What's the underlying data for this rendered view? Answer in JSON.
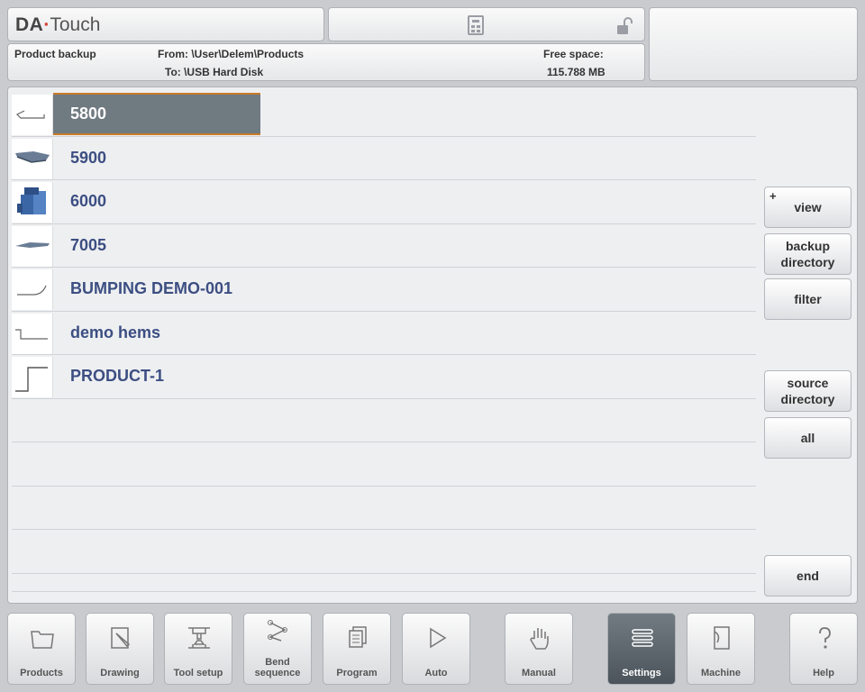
{
  "header": {
    "logo_bold": "DA",
    "logo_dot": "·",
    "logo_light": "Touch"
  },
  "status": {
    "mode": "Product backup",
    "from": "From: \\User\\Delem\\Products",
    "to": "To: \\USB Hard Disk",
    "free_space_label": "Free space:",
    "free_space_value": "115.788 MB"
  },
  "products": [
    {
      "name": "5800",
      "icon": "bend-profile-thumb",
      "selected": true
    },
    {
      "name": "5900",
      "icon": "sheet-3d-thumb"
    },
    {
      "name": "6000",
      "icon": "box-3d-thumb"
    },
    {
      "name": "7005",
      "icon": "flat-part-thumb"
    },
    {
      "name": "BUMPING DEMO-001",
      "icon": "bumping-profile-thumb"
    },
    {
      "name": "demo hems",
      "icon": "hem-profile-thumb"
    },
    {
      "name": "PRODUCT-1",
      "icon": "step-profile-thumb"
    }
  ],
  "side_buttons": {
    "view_plus": "+",
    "view": "view",
    "backup_dir_1": "backup",
    "backup_dir_2": "directory",
    "filter": "filter",
    "source_dir_1": "source",
    "source_dir_2": "directory",
    "all": "all",
    "end": "end"
  },
  "nav": {
    "products": "Products",
    "drawing": "Drawing",
    "tool_setup": "Tool setup",
    "bend_1": "Bend",
    "bend_2": "sequence",
    "program": "Program",
    "auto": "Auto",
    "manual": "Manual",
    "settings": "Settings",
    "machine": "Machine",
    "help": "Help"
  },
  "colors": {
    "selected_row": "#6f7a81",
    "selected_border": "#c97b2a",
    "product_text": "#3c4e82",
    "active_tab": "#5a636a"
  }
}
